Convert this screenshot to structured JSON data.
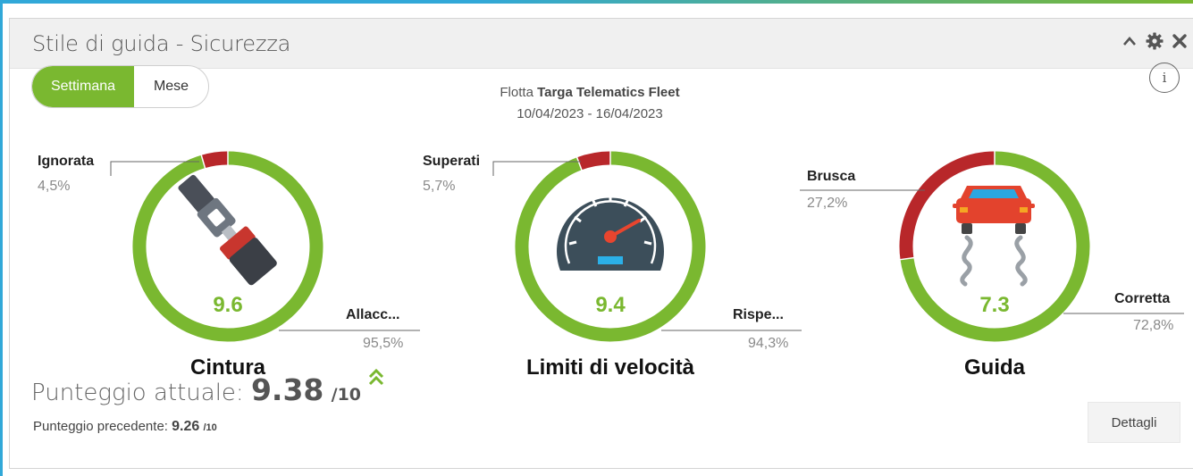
{
  "widget": {
    "title": "Stile di guida - Sicurezza",
    "icons": [
      "chevron-up-icon",
      "gear-icon",
      "close-icon"
    ]
  },
  "period_toggle": {
    "options": [
      "Settimana",
      "Mese"
    ],
    "selected": "Settimana"
  },
  "fleet": {
    "prefix": "Flotta",
    "name": "Targa Telematics Fleet",
    "date_range": "10/04/2023 - 16/04/2023"
  },
  "info_label": "i",
  "colors": {
    "good": "#7ab830",
    "bad": "#b8272a",
    "accent_blue": "#31a8d8"
  },
  "chart_data": [
    {
      "type": "pie",
      "title": "Cintura",
      "score": "9.6",
      "icon": "seatbelt-icon",
      "slices": [
        {
          "label": "Ignorata",
          "value": 4.5,
          "display": "4,5%",
          "color": "#b8272a"
        },
        {
          "label": "Allacc...",
          "value": 95.5,
          "display": "95,5%",
          "color": "#7ab830"
        }
      ]
    },
    {
      "type": "pie",
      "title": "Limiti di velocità",
      "score": "9.4",
      "icon": "speedometer-icon",
      "slices": [
        {
          "label": "Superati",
          "value": 5.7,
          "display": "5,7%",
          "color": "#b8272a"
        },
        {
          "label": "Rispe...",
          "value": 94.3,
          "display": "94,3%",
          "color": "#7ab830"
        }
      ]
    },
    {
      "type": "pie",
      "title": "Guida",
      "score": "7.3",
      "icon": "skidding-car-icon",
      "slices": [
        {
          "label": "Brusca",
          "value": 27.2,
          "display": "27,2%",
          "color": "#b8272a"
        },
        {
          "label": "Corretta",
          "value": 72.8,
          "display": "72,8%",
          "color": "#7ab830"
        }
      ]
    }
  ],
  "current_score": {
    "label": "Punteggio attuale:",
    "value": "9.38",
    "unit": "/10",
    "trend": "up"
  },
  "previous_score": {
    "label": "Punteggio precedente:",
    "value": "9.26",
    "unit": "/10"
  },
  "details_button": "Dettagli"
}
